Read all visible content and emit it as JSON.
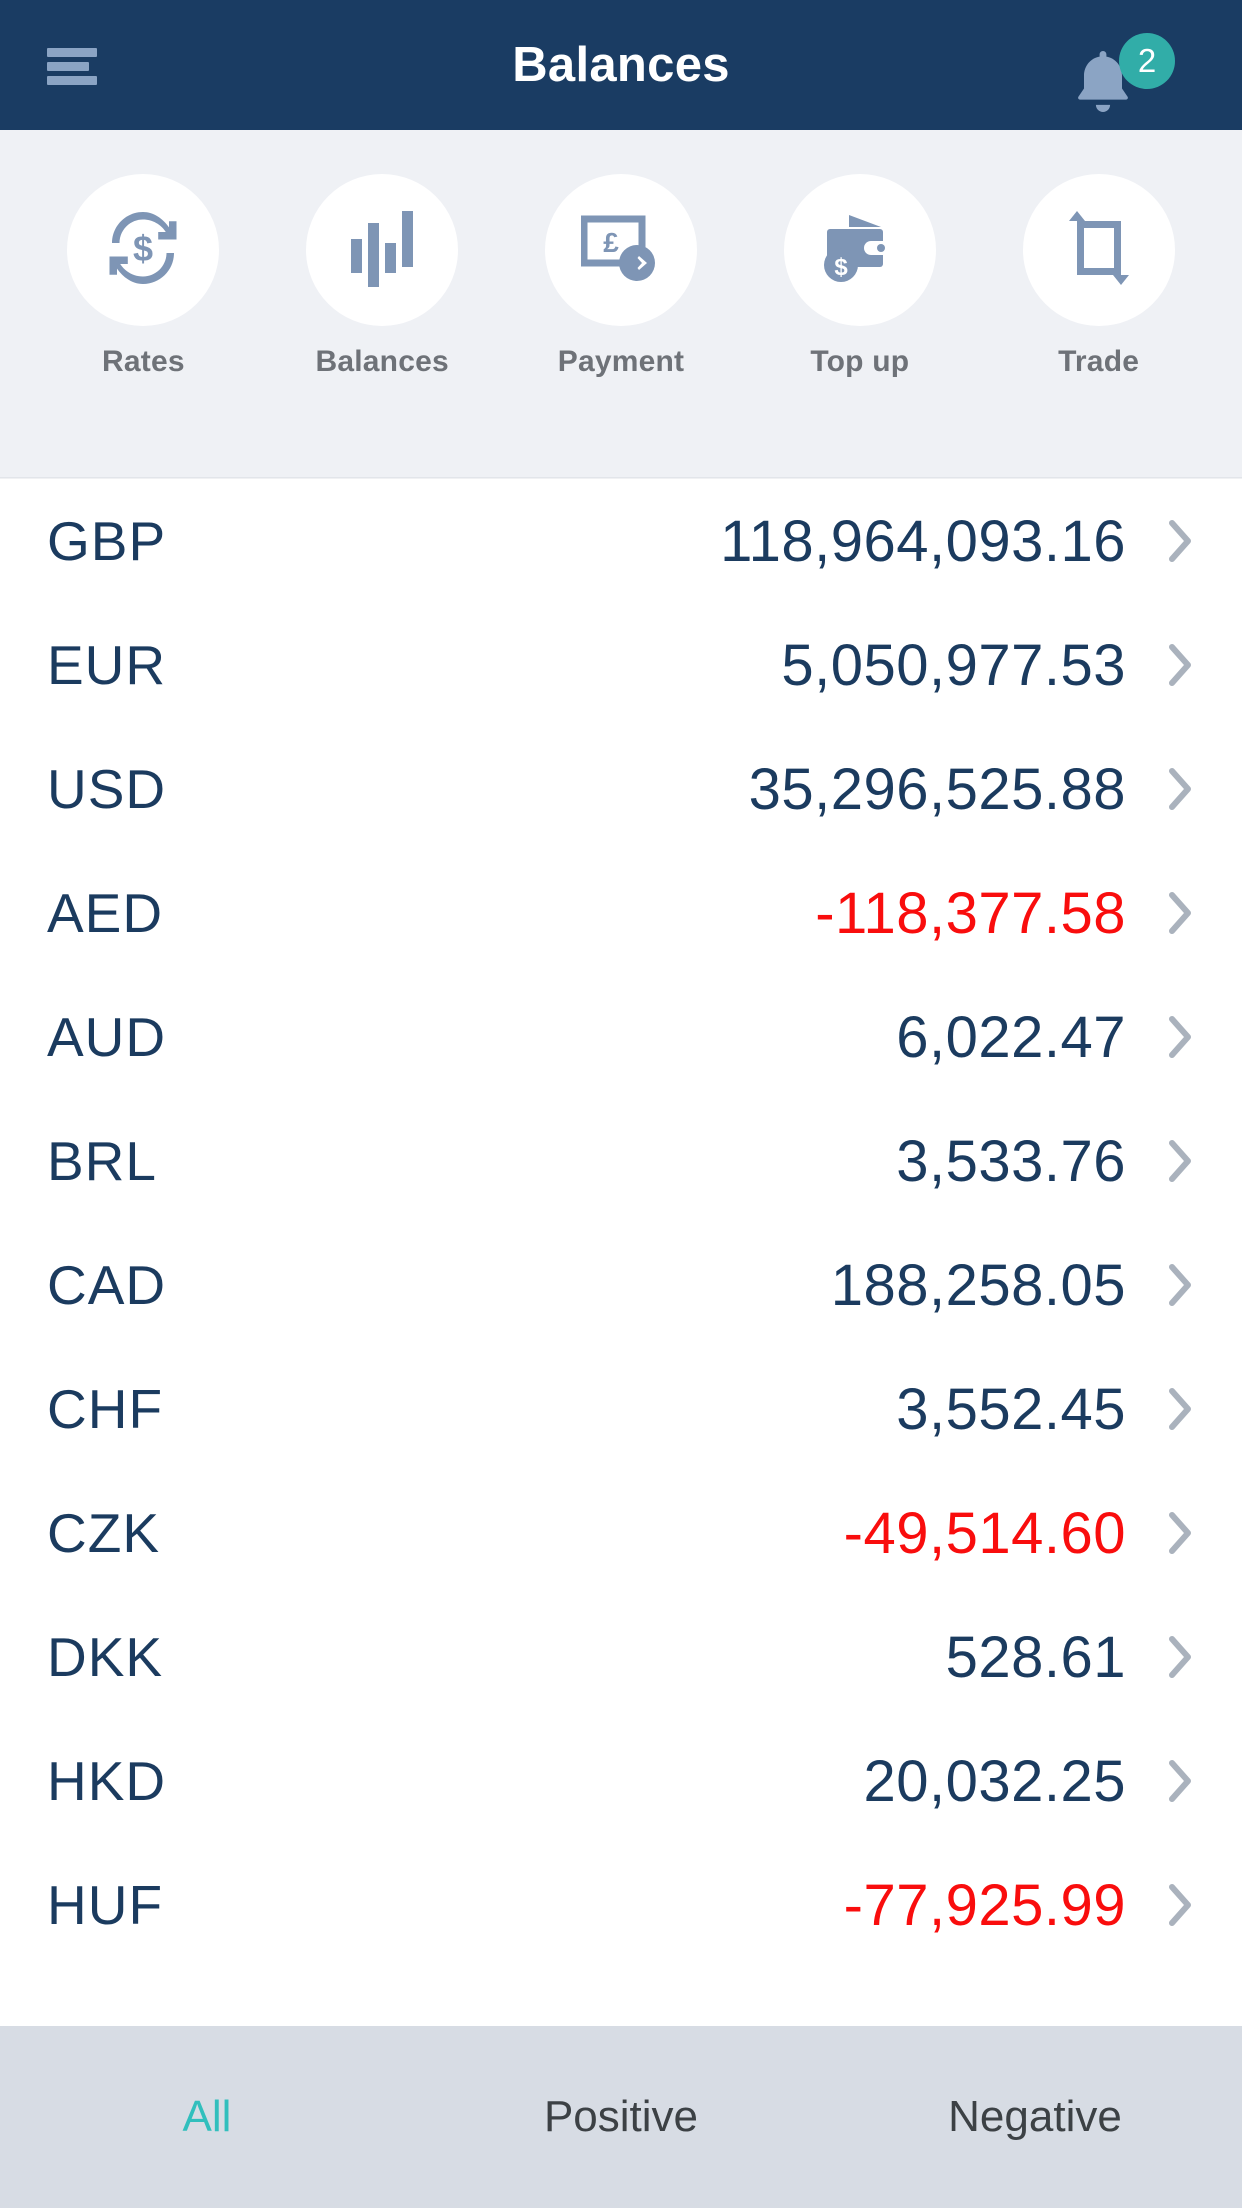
{
  "header": {
    "title": "Balances",
    "menu_icon": "hamburger-menu-icon",
    "notifications_icon": "bell-icon",
    "notifications_count": "2",
    "background_color": "#1a3c63",
    "badge_color": "#31ada8"
  },
  "actions": [
    {
      "label": "Rates",
      "icon": "currency-exchange-circle-icon"
    },
    {
      "label": "Balances",
      "icon": "bar-chart-icon"
    },
    {
      "label": "Payment",
      "icon": "banknote-pound-arrow-icon"
    },
    {
      "label": "Top up",
      "icon": "wallet-dollar-icon"
    },
    {
      "label": "Trade",
      "icon": "swap-arrows-icon"
    }
  ],
  "balances": [
    {
      "code": "GBP",
      "amount": "118,964,093.16",
      "negative": false
    },
    {
      "code": "EUR",
      "amount": "5,050,977.53",
      "negative": false
    },
    {
      "code": "USD",
      "amount": "35,296,525.88",
      "negative": false
    },
    {
      "code": "AED",
      "amount": "-118,377.58",
      "negative": true
    },
    {
      "code": "AUD",
      "amount": "6,022.47",
      "negative": false
    },
    {
      "code": "BRL",
      "amount": "3,533.76",
      "negative": false
    },
    {
      "code": "CAD",
      "amount": "188,258.05",
      "negative": false
    },
    {
      "code": "CHF",
      "amount": "3,552.45",
      "negative": false
    },
    {
      "code": "CZK",
      "amount": "-49,514.60",
      "negative": true
    },
    {
      "code": "DKK",
      "amount": "528.61",
      "negative": false
    },
    {
      "code": "HKD",
      "amount": "20,032.25",
      "negative": false
    },
    {
      "code": "HUF",
      "amount": "-77,925.99",
      "negative": true
    }
  ],
  "footer": {
    "tabs": [
      {
        "label": "All",
        "active": true
      },
      {
        "label": "Positive",
        "active": false
      },
      {
        "label": "Negative",
        "active": false
      }
    ],
    "active_color": "#31bfbd",
    "background_color": "#d7dce4"
  },
  "colors": {
    "navy": "#1b3b5f",
    "negative": "#f90d0d",
    "icon_blue": "#7e95b5",
    "chevron": "#aab2bd"
  }
}
